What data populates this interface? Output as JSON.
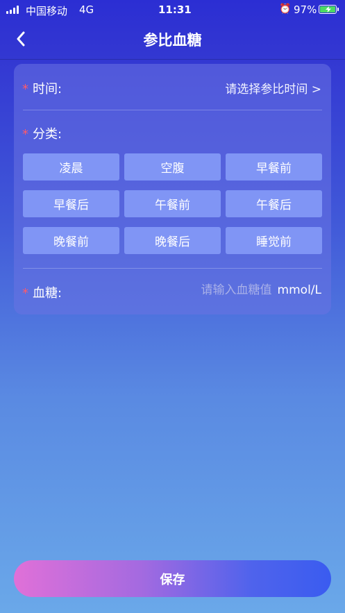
{
  "status_bar": {
    "carrier": "中国移动",
    "network": "4G",
    "time": "11:31",
    "battery": "97%"
  },
  "header": {
    "title": "参比血糖",
    "back_icon": "chevron-left-icon"
  },
  "form": {
    "time": {
      "required_mark": "*",
      "label": "时间:",
      "value": "请选择参比时间 >"
    },
    "category": {
      "required_mark": "*",
      "label": "分类:",
      "options": [
        "凌晨",
        "空腹",
        "早餐前",
        "早餐后",
        "午餐前",
        "午餐后",
        "晚餐前",
        "晚餐后",
        "睡觉前"
      ]
    },
    "blood_sugar": {
      "required_mark": "*",
      "label": "血糖:",
      "placeholder": "请输入血糖值",
      "value": "",
      "unit": "mmol/L"
    }
  },
  "save_button": {
    "label": "保存"
  },
  "colors": {
    "required_star": "#ff5a6a",
    "option_button": "#8095f5",
    "save_gradient_start": "#e070d8",
    "save_gradient_end": "#3a5cf0"
  }
}
